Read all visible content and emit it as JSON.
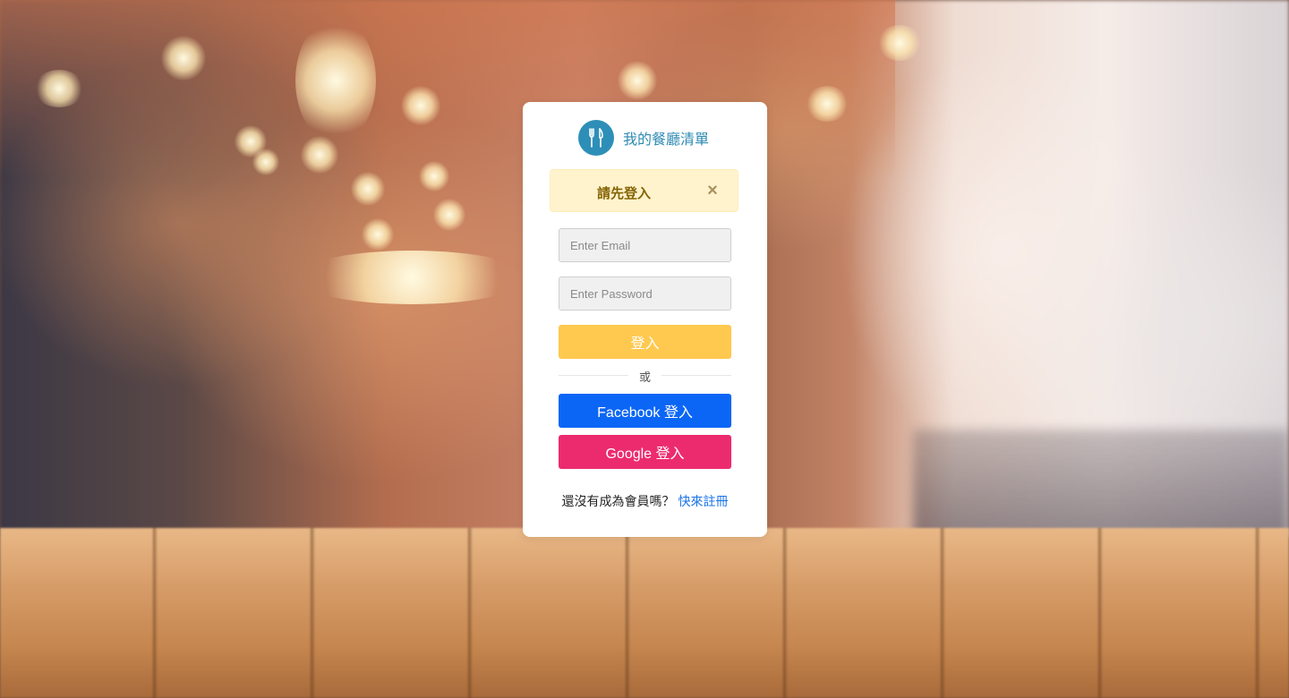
{
  "brand": {
    "name": "我的餐廳清單",
    "logo_icon": "utensils-icon",
    "logo_color": "#2d8fb7"
  },
  "alert": {
    "message": "請先登入",
    "close_icon": "close-icon",
    "close_glyph": "×"
  },
  "login_form": {
    "email_placeholder": "Enter Email",
    "password_placeholder": "Enter Password",
    "email_value": "",
    "password_value": "",
    "submit_label": "登入",
    "submit_color": "#ffc94f"
  },
  "divider": {
    "label": "或"
  },
  "social": {
    "facebook_label": "Facebook 登入",
    "facebook_color": "#0b66f5",
    "google_label": "Google 登入",
    "google_color": "#ec2b6f"
  },
  "signup": {
    "prompt": "還沒有成為會員嗎？",
    "link_label": "快來註冊"
  }
}
